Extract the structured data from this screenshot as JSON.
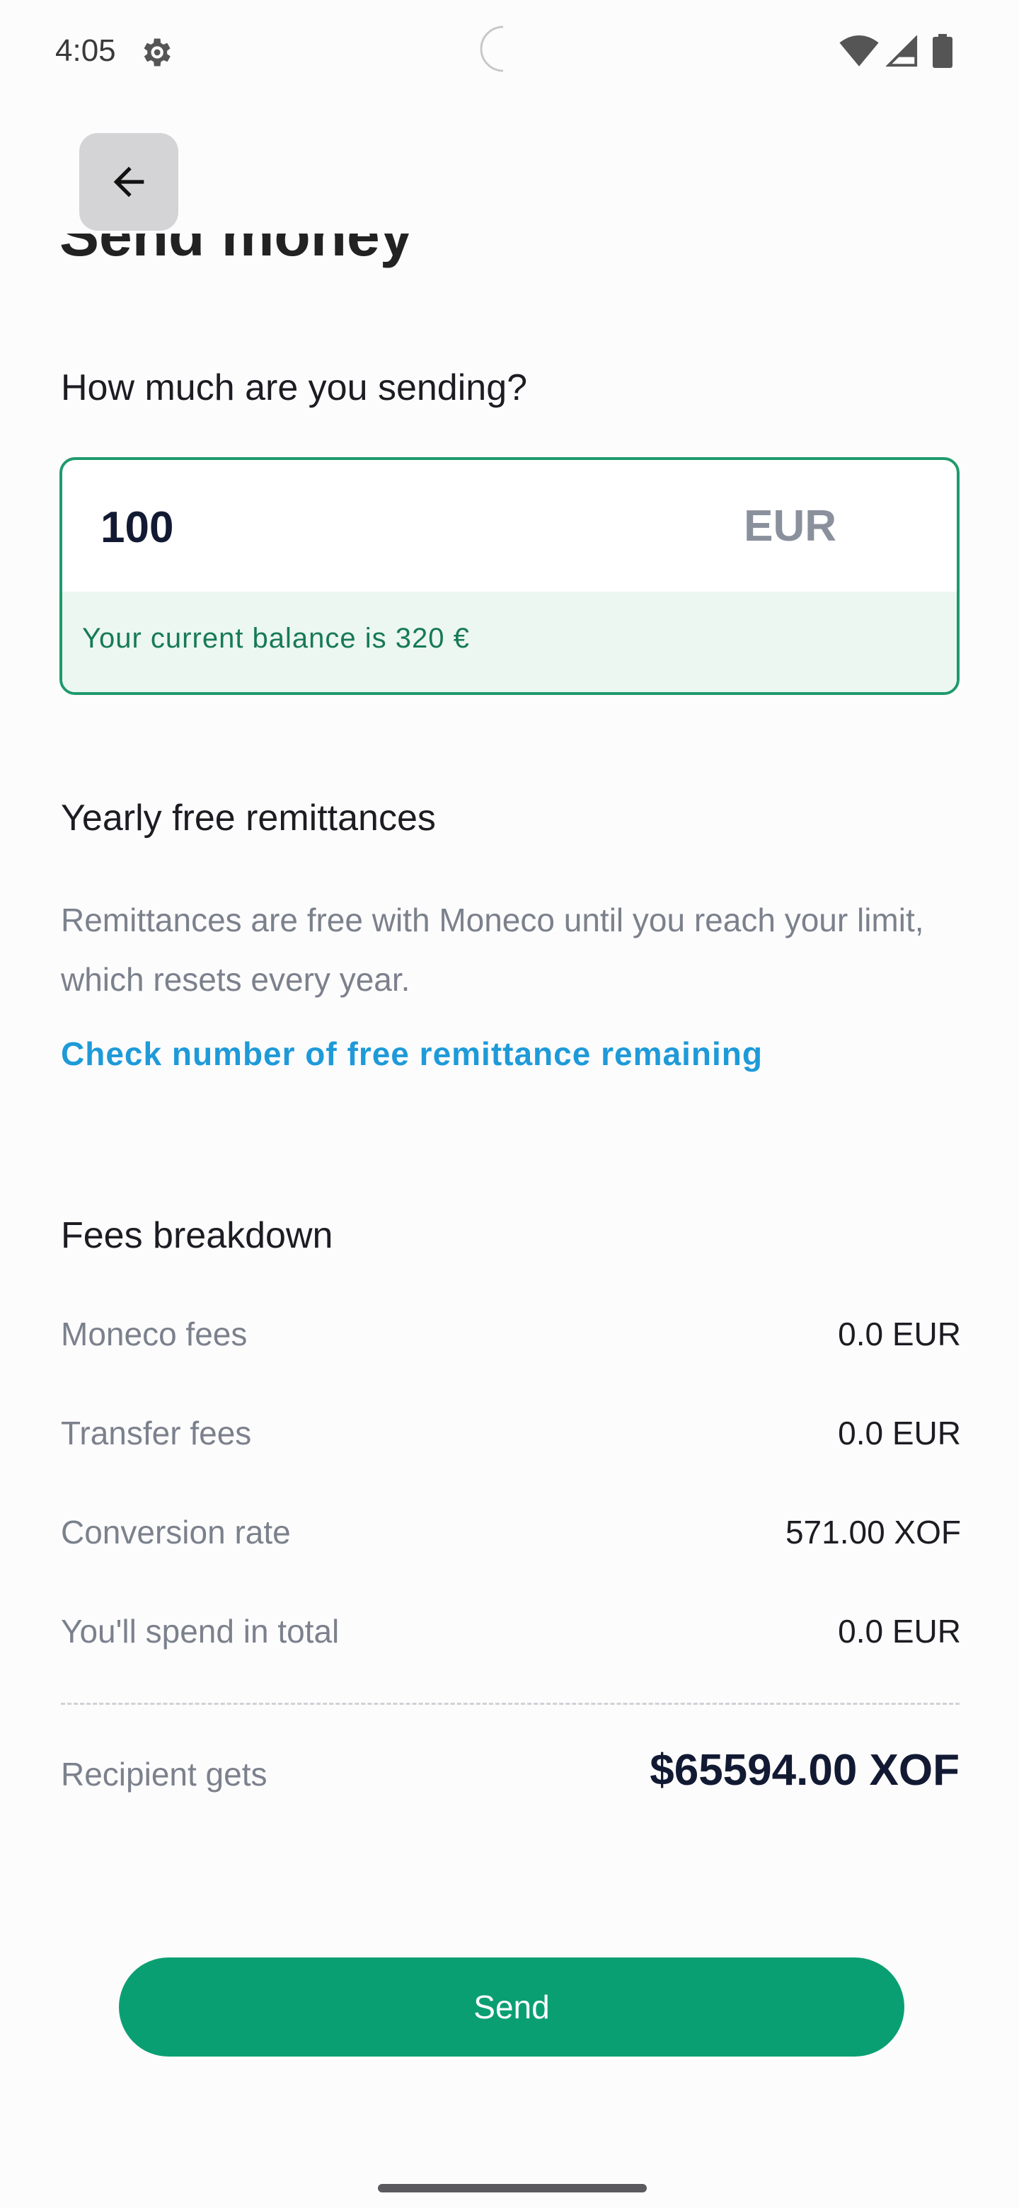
{
  "status_bar": {
    "time": "4:05",
    "icons": [
      "settings-gear-icon",
      "camera-cutout-icon",
      "wifi-icon",
      "cellular-signal-icon",
      "battery-icon"
    ]
  },
  "header": {
    "back_icon": "arrow-left-icon",
    "title": "Send money"
  },
  "amount": {
    "label": "How much are you sending?",
    "value": "100",
    "currency": "EUR",
    "balance_text": "Your current balance is 320 €"
  },
  "remittances": {
    "title": "Yearly free remittances",
    "description": "Remittances are free with Moneco until you reach your limit, which resets every year.",
    "link": "Check number of free remittance remaining"
  },
  "fees": {
    "title": "Fees breakdown",
    "rows": [
      {
        "label": "Moneco fees",
        "value": "0.0 EUR"
      },
      {
        "label": "Transfer fees",
        "value": "0.0 EUR"
      },
      {
        "label": "Conversion rate",
        "value": "571.00 XOF"
      },
      {
        "label": "You'll spend in total",
        "value": "0.0 EUR"
      }
    ],
    "recipient_label": "Recipient gets",
    "recipient_value": "$65594.00 XOF"
  },
  "actions": {
    "send_label": "Send"
  },
  "colors": {
    "accent": "#0a9f72",
    "border": "#1f9a6d",
    "balance_bg": "#ecf7f2",
    "link": "#1e9ad8"
  }
}
